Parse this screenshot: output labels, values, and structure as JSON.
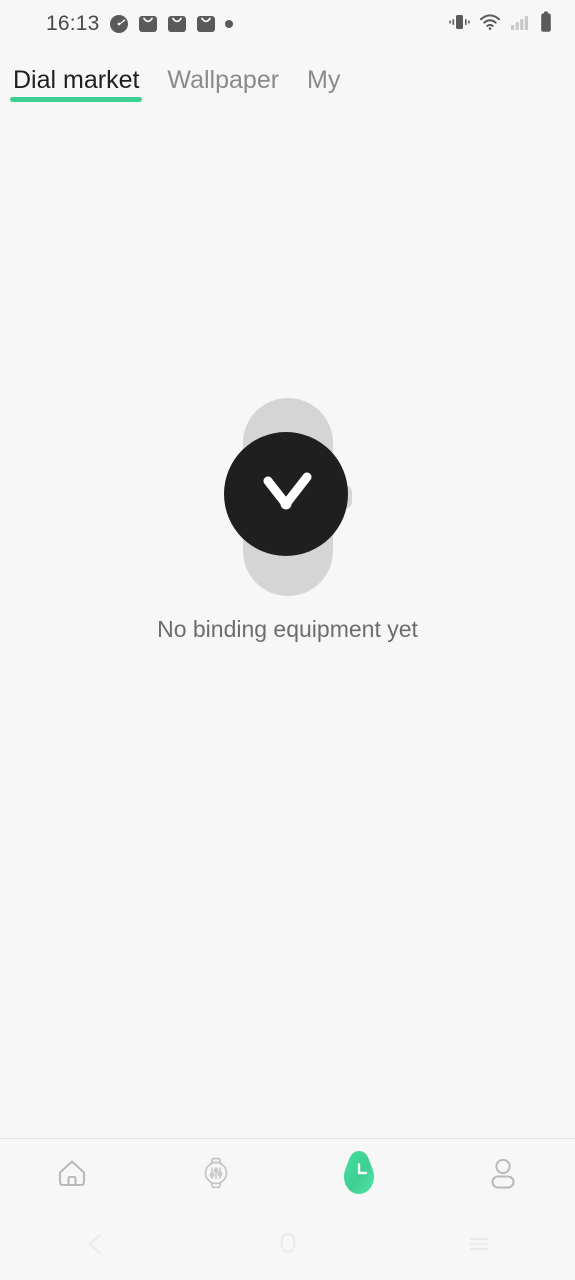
{
  "status_bar": {
    "time": "16:13",
    "left_icons": [
      {
        "name": "gauge-icon",
        "label": "gauge"
      },
      {
        "name": "mail-icon-1",
        "label": "mail"
      },
      {
        "name": "mail-icon-2",
        "label": "mail"
      },
      {
        "name": "mail-icon-3",
        "label": "mail"
      },
      {
        "name": "dot-indicator-icon",
        "label": "dot"
      }
    ],
    "right_icons": [
      {
        "name": "vibrate-icon",
        "label": "vibrate"
      },
      {
        "name": "wifi-icon",
        "label": "wifi"
      },
      {
        "name": "cellular-signal-icon",
        "label": "signal"
      },
      {
        "name": "battery-icon",
        "label": "battery"
      }
    ]
  },
  "tabs": [
    {
      "label": "Dial market",
      "active": true
    },
    {
      "label": "Wallpaper",
      "active": false
    },
    {
      "label": "My",
      "active": false
    }
  ],
  "empty_state": {
    "illustration": "smartwatch-illustration",
    "message": "No binding equipment yet"
  },
  "bottom_nav": [
    {
      "name": "nav-home",
      "icon": "home-icon",
      "active": false
    },
    {
      "name": "nav-device",
      "icon": "watch-settings-icon",
      "active": false
    },
    {
      "name": "nav-dial",
      "icon": "clock-blob-icon",
      "active": true
    },
    {
      "name": "nav-profile",
      "icon": "person-icon",
      "active": false
    }
  ],
  "system_nav": [
    {
      "name": "system-back",
      "icon": "back-chevron-icon"
    },
    {
      "name": "system-home",
      "icon": "home-circle-icon"
    },
    {
      "name": "system-recents",
      "icon": "recents-menu-icon"
    }
  ],
  "colors": {
    "accent": "#3ecf92",
    "background": "#f7f7f7",
    "tab_active_text": "#1f1f1f",
    "tab_inactive_text": "#8a8a8a",
    "empty_text": "#6d6d6d",
    "watch_band": "#d5d5d5",
    "watch_face": "#1f1f1f",
    "nav_icon": "#b9b9b9",
    "status_icon": "#5a5a5a"
  }
}
